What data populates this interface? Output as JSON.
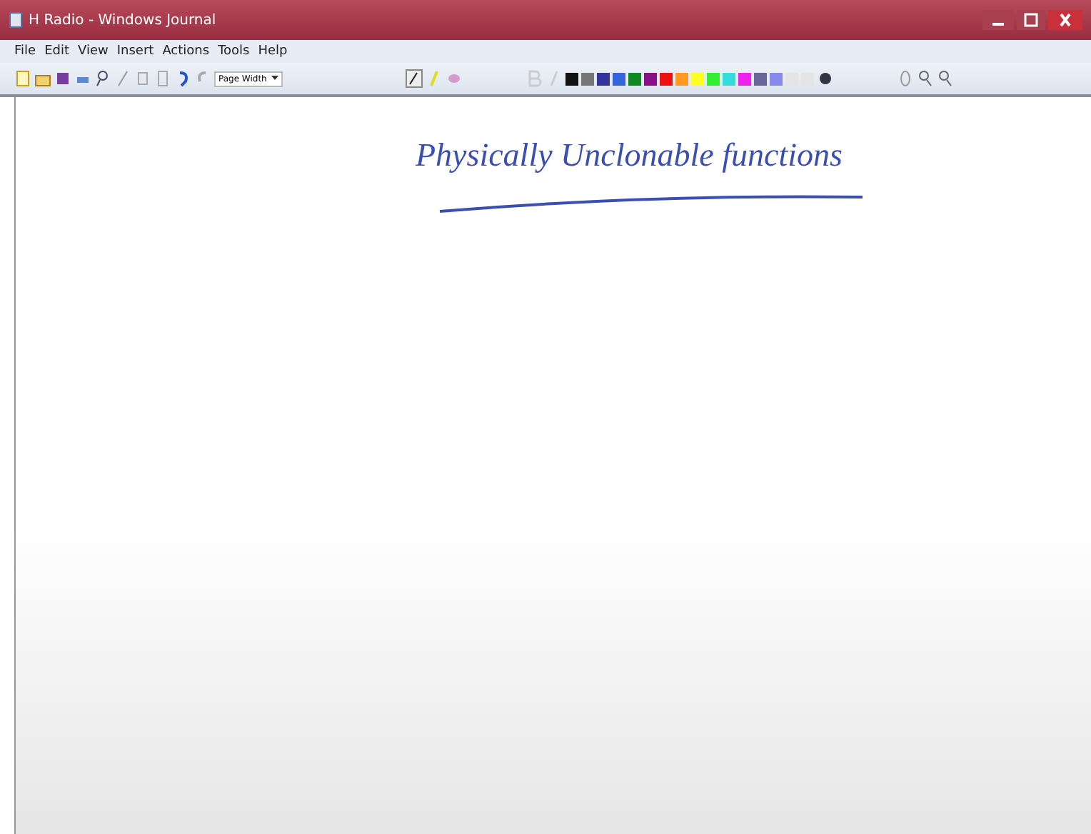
{
  "window": {
    "title": "H Radio - Windows Journal"
  },
  "menu": [
    "File",
    "Edit",
    "View",
    "Insert",
    "Actions",
    "Tools",
    "Help"
  ],
  "toolbar": {
    "zoom_select": {
      "value": "Page Width"
    },
    "pen_colors": [
      {
        "color": "#111111"
      },
      {
        "color": "#777777"
      },
      {
        "color": "#333399"
      },
      {
        "color": "#3366dd"
      },
      {
        "color": "#118822"
      },
      {
        "color": "#881188"
      },
      {
        "color": "#ee1111"
      },
      {
        "color": "#ff9922"
      },
      {
        "color": "#ffff22"
      },
      {
        "color": "#33ee33"
      },
      {
        "color": "#33dddd"
      },
      {
        "color": "#ee22ee"
      },
      {
        "color": "#666699"
      },
      {
        "color": "#8888ee"
      },
      {
        "color": "#e4e4e4"
      },
      {
        "color": "#e4e4e4"
      }
    ]
  },
  "page": {
    "heading": "Physically Unclonable functions"
  }
}
